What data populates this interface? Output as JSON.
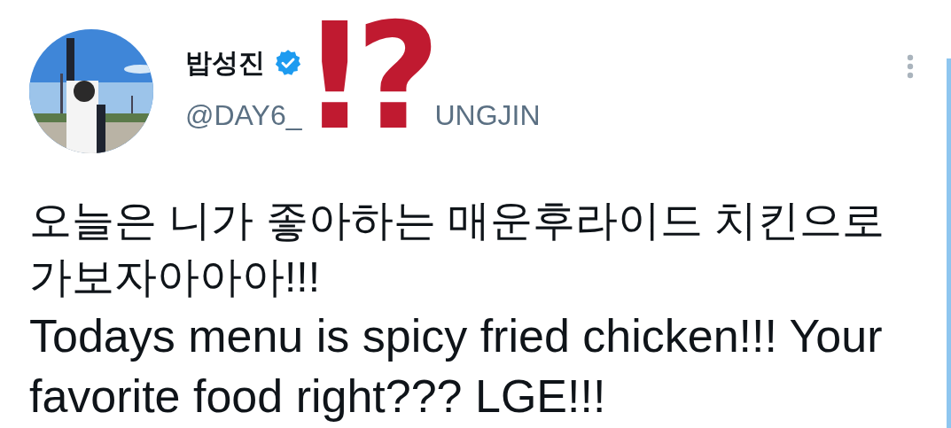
{
  "tweet": {
    "display_name": "밥성진",
    "verified": true,
    "handle": {
      "before_sticker": "@DAY6_",
      "after_sticker": "UNGJIN"
    },
    "text_korean": "오늘은 니가 좋아하는 매운후라이드 치킨으로\n가보자아아아!!!",
    "text_english": "Todays menu is spicy fried chicken!!! Your\nfavorite food right??? LGE!!!"
  },
  "sticker": [
    "!",
    "?"
  ]
}
